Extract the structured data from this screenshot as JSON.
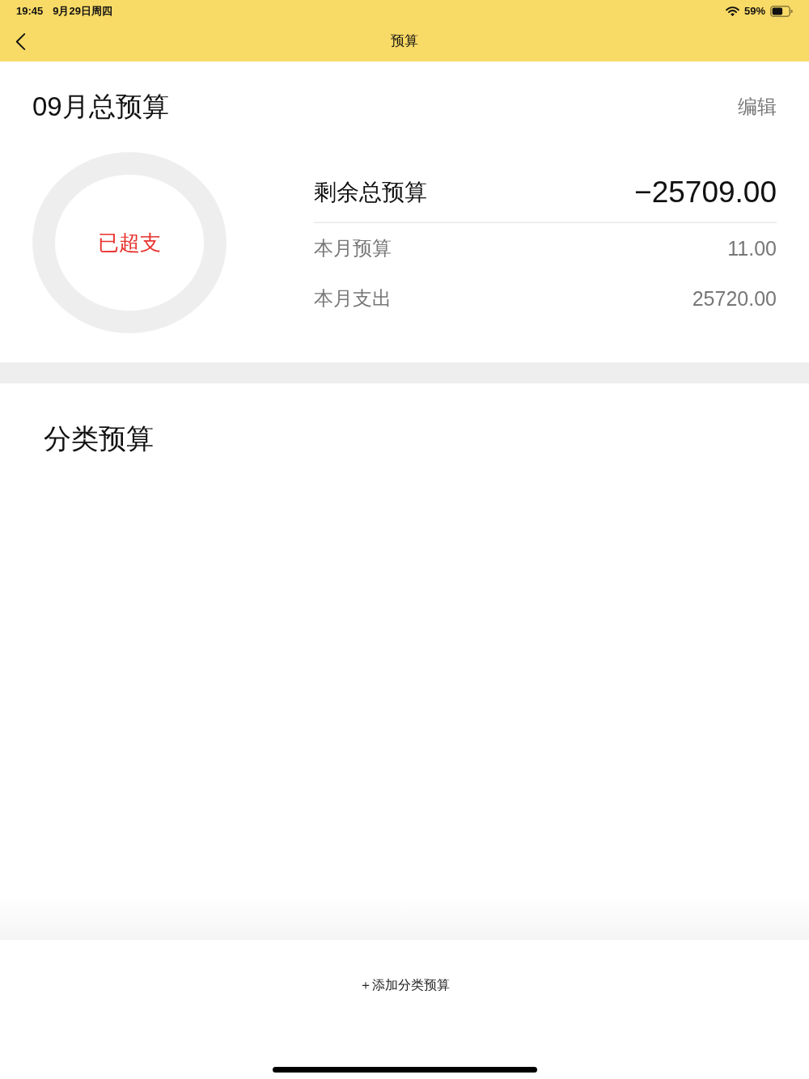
{
  "status_bar": {
    "time": "19:45",
    "date": "9月29日周四",
    "battery": "59%"
  },
  "nav_bar": {
    "title": "预算"
  },
  "budget_summary": {
    "title": "09月总预算",
    "edit_label": "编辑",
    "ring_status": "已超支",
    "remaining": {
      "label": "剩余总预算",
      "value": "−25709.00"
    },
    "rows": [
      {
        "label": "本月预算",
        "value": "11.00"
      },
      {
        "label": "本月支出",
        "value": "25720.00"
      }
    ]
  },
  "category_budget": {
    "title": "分类预算"
  },
  "add_button": {
    "label": "＋添加分类预算"
  }
}
